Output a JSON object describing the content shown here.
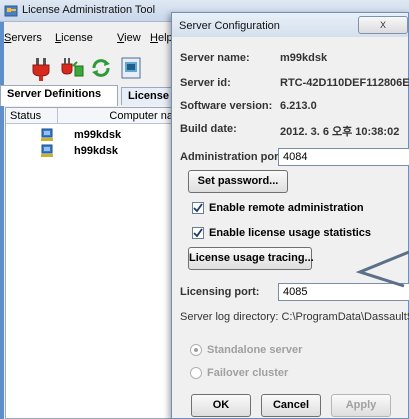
{
  "main_window": {
    "title": "License Administration Tool",
    "menu": [
      {
        "underline": "S",
        "rest": "ervers"
      },
      {
        "underline": "L",
        "rest": "icense"
      },
      {
        "underline": "V",
        "rest": "iew"
      },
      {
        "underline": "H",
        "rest": "elp"
      }
    ],
    "toolbar": {
      "icons": [
        "plug-connect-icon",
        "plug-disconnect-icon",
        "refresh-icon",
        "properties-icon"
      ]
    },
    "tabs": [
      "Server Definitions",
      "License A"
    ],
    "table": {
      "columns": [
        "Status",
        "Computer na"
      ],
      "rows": [
        {
          "name": "m99kdsk"
        },
        {
          "name": "h99kdsk"
        }
      ]
    }
  },
  "dialog": {
    "title": "Server Configuration",
    "close_label": "X",
    "info": [
      {
        "label": "Server name:",
        "value": "m99kdsk"
      },
      {
        "label": "Server id:",
        "value": "RTC-42D110DEF112806E"
      },
      {
        "label": "Software version:",
        "value": "6.213.0"
      },
      {
        "label": "Build date:",
        "value": "2012. 3. 6 오후 10:38:02"
      }
    ],
    "admin_port_label": "Administration port:",
    "admin_port_value": "4084",
    "set_password_label": "Set password...",
    "enable_remote_label": "Enable remote administration",
    "enable_stats_label": "Enable license usage statistics",
    "tracing_label": "License usage tracing...",
    "licensing_port_label": "Licensing port:",
    "licensing_port_value": "4085",
    "log_dir_text": "Server log directory: C:\\ProgramData\\DassaultSys",
    "standalone_label": "Standalone server",
    "failover_label": "Failover cluster",
    "ok_label": "OK",
    "cancel_label": "Cancel",
    "apply_label": "Apply"
  },
  "colors": {
    "arrow": "#5b6f88",
    "titlebar": "#d4e0ee",
    "disabled_text": "#a0a0a0"
  }
}
